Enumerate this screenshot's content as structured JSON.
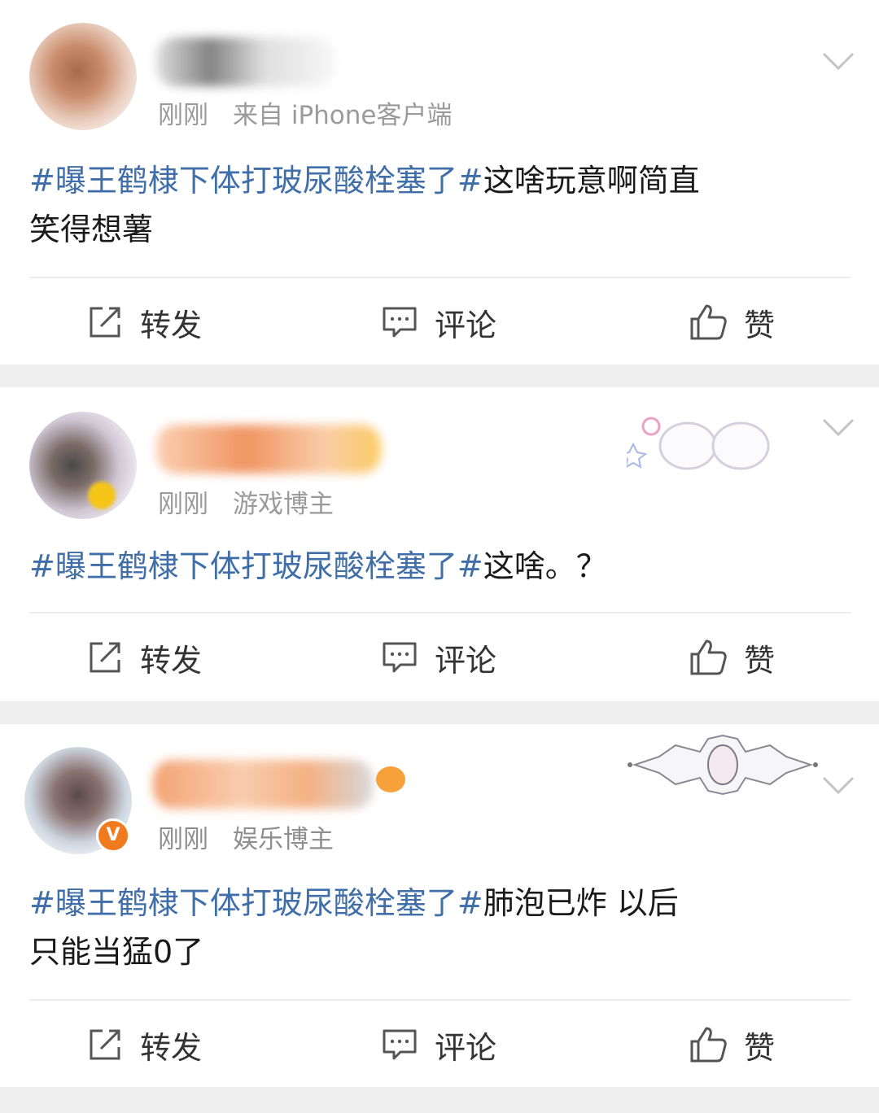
{
  "posts": [
    {
      "meta": {
        "time": "刚刚",
        "source": "来自 iPhone客户端"
      },
      "hashtag": "#曝王鹤棣下体打玻尿酸栓塞了#",
      "body": "这啥玩意啊简直",
      "body2": "笑得想薯",
      "actions": {
        "repost": "转发",
        "comment": "评论",
        "like": "赞"
      },
      "verified": false
    },
    {
      "meta": {
        "time": "刚刚",
        "source": "游戏博主"
      },
      "hashtag": "#曝王鹤棣下体打玻尿酸栓塞了#",
      "body": "这啥。？",
      "actions": {
        "repost": "转发",
        "comment": "评论",
        "like": "赞"
      },
      "verified": false
    },
    {
      "meta": {
        "time": "刚刚",
        "source": "娱乐博主"
      },
      "hashtag": "#曝王鹤棣下体打玻尿酸栓塞了#",
      "body": "肺泡已炸  以后",
      "body2": "只能当猛0了",
      "actions": {
        "repost": "转发",
        "comment": "评论",
        "like": "赞"
      },
      "verified": true,
      "badge": "V"
    }
  ],
  "colors": {
    "hashtag": "#3f6ea8",
    "meta": "#9a9a9a",
    "separator": "#efefef",
    "badge": "#f07a1d"
  },
  "icons": [
    "chevron-down-icon",
    "repost-icon",
    "comment-icon",
    "like-icon",
    "verified-badge-icon"
  ]
}
